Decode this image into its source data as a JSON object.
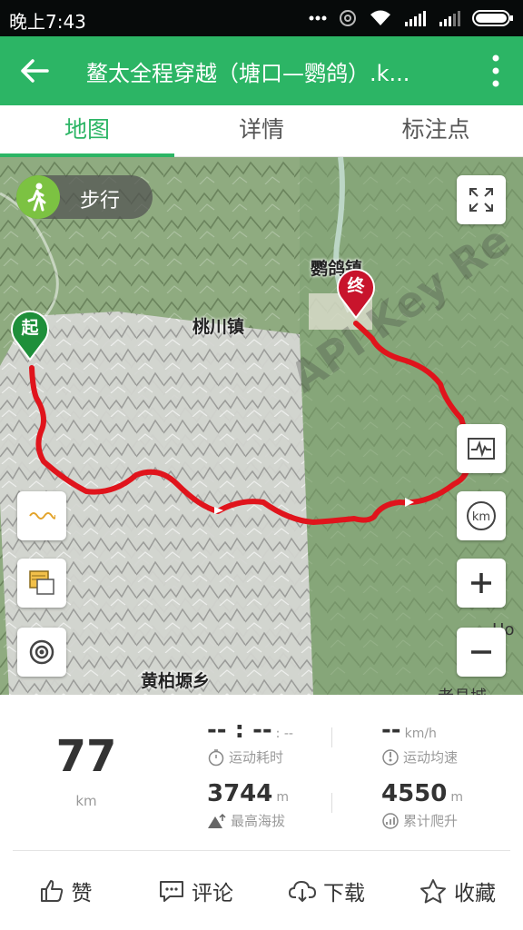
{
  "status_bar": {
    "time": "晚上7:43",
    "icons": [
      "more-dots-icon",
      "signal-circle-icon",
      "wifi-icon",
      "cell-signal-icon",
      "cell-signal-2-icon",
      "battery-icon"
    ]
  },
  "app_bar": {
    "title": "鳌太全程穿越（塘口—鹦鸽）.k...",
    "back_icon": "arrow-left-icon",
    "more_icon": "more-vertical-icon",
    "color": "#2cb565"
  },
  "tabs": [
    {
      "label": "地图",
      "active": true
    },
    {
      "label": "详情",
      "active": false
    },
    {
      "label": "标注点",
      "active": false
    }
  ],
  "map": {
    "mode_label": "步行",
    "labels": {
      "town1": "桃川镇",
      "town2": "鹦鸽镇",
      "town3": "黄柏塬乡",
      "edge_right": "Ho",
      "edge_bottom": "老县城"
    },
    "watermark": "API Key Re",
    "start_marker": "起",
    "end_marker": "终",
    "route_color": "#e0141c",
    "controls": [
      "fullscreen-icon",
      "elevation-profile-icon",
      "km-icon",
      "zoom-in-icon",
      "zoom-out-icon",
      "track-line-icon",
      "layers-icon",
      "locate-icon"
    ]
  },
  "stats": {
    "distance": {
      "value": "77",
      "unit": "km"
    },
    "duration": {
      "value": "-- : --",
      "unit": ": --",
      "label": "运动耗时"
    },
    "avg_speed": {
      "value": "--",
      "unit": "km/h",
      "label": "运动均速"
    },
    "max_altitude": {
      "value": "3744",
      "unit": "m",
      "label": "最高海拔"
    },
    "total_climb": {
      "value": "4550",
      "unit": "m",
      "label": "累计爬升"
    }
  },
  "actions": [
    {
      "label": "赞",
      "icon": "thumbs-up-icon"
    },
    {
      "label": "评论",
      "icon": "comment-icon"
    },
    {
      "label": "下载",
      "icon": "cloud-download-icon"
    },
    {
      "label": "收藏",
      "icon": "star-icon"
    }
  ]
}
